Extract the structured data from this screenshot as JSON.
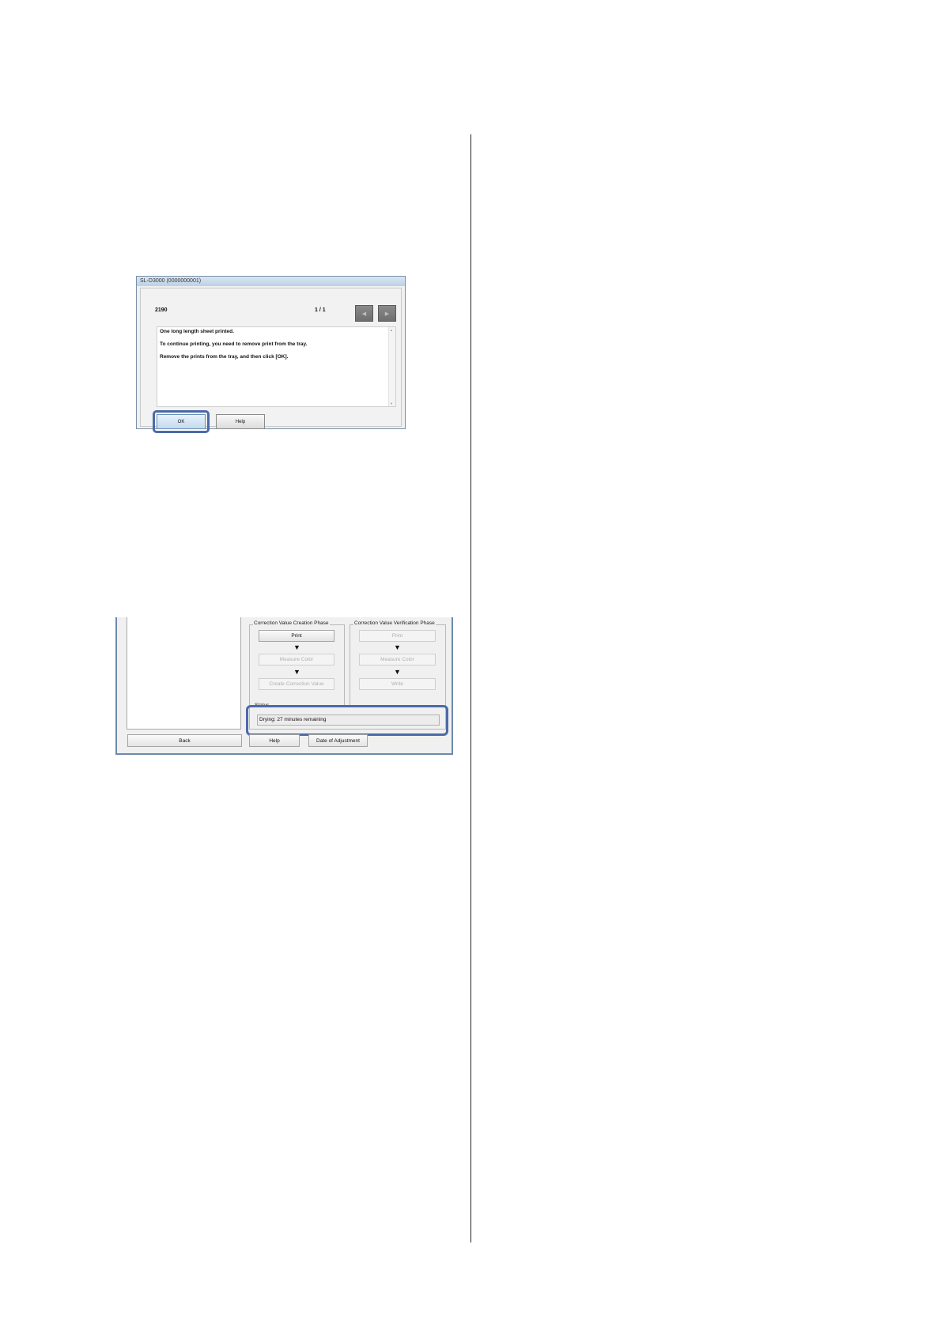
{
  "error_dialog": {
    "window_title": "SL-D3000 (0000000001)",
    "error_code": "2190",
    "page_indicator": "1 / 1",
    "prev_icon": "chevron-left-icon",
    "next_icon": "chevron-right-icon",
    "message_lines": [
      "One long length sheet printed.",
      "To continue printing, you need to remove print from the tray.",
      "Remove the prints from the tray, and then click [OK]."
    ],
    "ok_label": "OK",
    "help_label": "Help",
    "highlight_color": "#4c6aa8"
  },
  "adjustment_window": {
    "creation_phase": {
      "legend": "Correction Value Creation Phase",
      "print_label": "Print",
      "measure_label": "Measure Color",
      "create_label": "Create Correction Value"
    },
    "verification_phase": {
      "legend": "Correction Value Verification Phase",
      "print_label": "Print",
      "measure_label": "Measure Color",
      "write_label": "Write"
    },
    "arrow_glyph": "▼",
    "status": {
      "legend": "Status",
      "text": "Drying: 27 minutes remaining"
    },
    "back_label": "Back",
    "help_label": "Help",
    "date_label": "Date of Adjustment",
    "highlight_color": "#4c6aa8"
  }
}
